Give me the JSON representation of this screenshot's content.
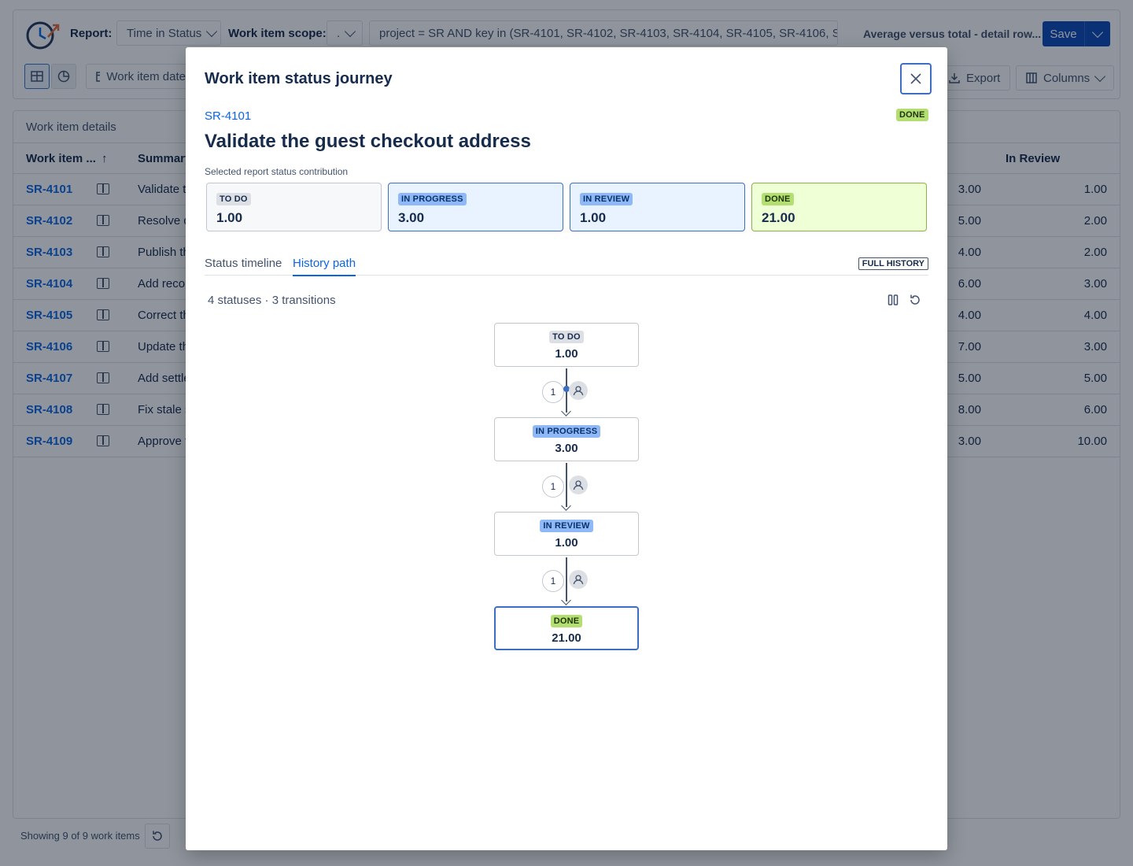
{
  "header": {
    "report_label": "Report:",
    "report_value": "Time in Status",
    "scope_label": "Work item scope:",
    "scope_value": ".",
    "jql": "project = SR AND key in (SR-4101, SR-4102, SR-4103, SR-4104, SR-4105, SR-4106, S...",
    "mode_text": "Average versus total - detail row...",
    "save_label": "Save",
    "date_button": "Work item date",
    "export_label": "Export",
    "columns_label": "Columns"
  },
  "grid": {
    "title": "Work item details",
    "col_key": "Work item ...",
    "col_summary": "Summary",
    "col_in_review": "In Review",
    "rows": [
      {
        "key": "SR-4101",
        "summary": "Validate t",
        "v1": "3.00",
        "v2": "1.00"
      },
      {
        "key": "SR-4102",
        "summary": "Resolve d",
        "v1": "5.00",
        "v2": "2.00"
      },
      {
        "key": "SR-4103",
        "summary": "Publish th",
        "v1": "4.00",
        "v2": "2.00"
      },
      {
        "key": "SR-4104",
        "summary": "Add reco",
        "v1": "6.00",
        "v2": "3.00"
      },
      {
        "key": "SR-4105",
        "summary": "Correct th",
        "v1": "4.00",
        "v2": "4.00"
      },
      {
        "key": "SR-4106",
        "summary": "Update th",
        "v1": "7.00",
        "v2": "3.00"
      },
      {
        "key": "SR-4107",
        "summary": "Add settle",
        "v1": "5.00",
        "v2": "5.00"
      },
      {
        "key": "SR-4108",
        "summary": "Fix stale s",
        "v1": "8.00",
        "v2": "6.00"
      },
      {
        "key": "SR-4109",
        "summary": "Approve t",
        "v1": "3.00",
        "v2": "10.00"
      }
    ],
    "footer": "Showing 9 of 9 work items"
  },
  "modal": {
    "title": "Work item status journey",
    "issue_key": "SR-4101",
    "issue_status": "DONE",
    "summary": "Validate the guest checkout address",
    "contribution_label": "Selected report status contribution",
    "contributions": [
      {
        "status": "TO DO",
        "value": "1.00"
      },
      {
        "status": "IN PROGRESS",
        "value": "3.00"
      },
      {
        "status": "IN REVIEW",
        "value": "1.00"
      },
      {
        "status": "DONE",
        "value": "21.00"
      }
    ],
    "tabs": [
      "Status timeline",
      "History path"
    ],
    "active_tab": "History path",
    "full_history": "FULL HISTORY",
    "summary_line": "4 statuses · 3 transitions",
    "path": [
      {
        "status": "TO DO",
        "value": "1.00"
      },
      {
        "status": "IN PROGRESS",
        "value": "3.00"
      },
      {
        "status": "IN REVIEW",
        "value": "1.00"
      },
      {
        "status": "DONE",
        "value": "21.00"
      }
    ],
    "transitions": [
      "1",
      "1",
      "1"
    ]
  },
  "colors": {
    "accent": "#0c66e4",
    "primary_button": "#0c4ab8",
    "done": "#b3df72",
    "in_progress": "#8fb8f6",
    "todo": "#dcdfe4"
  }
}
